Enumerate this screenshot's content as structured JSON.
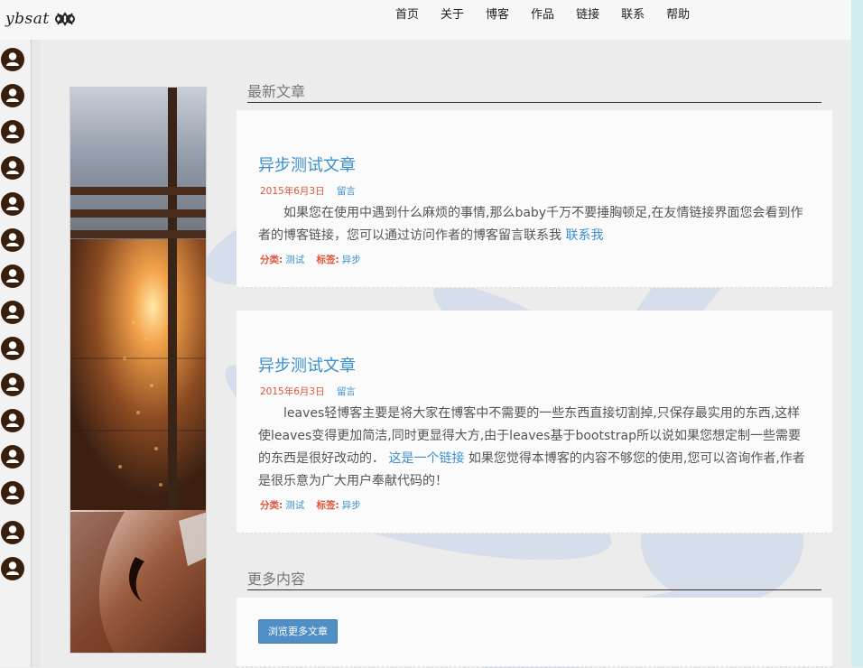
{
  "logo": {
    "text": "ybsat",
    "icon": "infinity-knot-icon"
  },
  "nav": [
    {
      "label": "首页"
    },
    {
      "label": "关于"
    },
    {
      "label": "博客"
    },
    {
      "label": "作品"
    },
    {
      "label": "链接"
    },
    {
      "label": "联系"
    },
    {
      "label": "帮助"
    }
  ],
  "latest": {
    "title": "最新文章"
  },
  "posts": [
    {
      "title": "异步测试文章",
      "date": "2015年6月3日",
      "comment": "留言",
      "body_text": "如果您在使用中遇到什么麻烦的事情,那么baby千万不要捶胸顿足,在友情链接界面您会看到作者的博客链接，您可以通过访问作者的博客留言联系我 ",
      "body_link": "联系我",
      "category_label": "分类:",
      "category": "测试",
      "tags_label": "标签:",
      "tag": "异步"
    },
    {
      "title": "异步测试文章",
      "date": "2015年6月3日",
      "comment": "留言",
      "body_text": "leaves轻博客主要是将大家在博客中不需要的一些东西直接切割掉,只保存最实用的东西,这样使leaves变得更加简洁,同时更显得大方,由于leaves基于bootstrap所以说如果您想定制一些需要的东西是很好改动的． ",
      "body_link": "这是一个链接",
      "body_text2": " 如果您觉得本博客的内容不够您的使用,您可以咨询作者,作者是很乐意为广大用户奉献代码的！",
      "category_label": "分类:",
      "category": "测试",
      "tags_label": "标签:",
      "tag": "异步"
    }
  ],
  "more": {
    "title": "更多内容",
    "button": "浏览更多文章"
  },
  "colors": {
    "accent": "#3a8fd0",
    "meta": "#e0533a",
    "button": "#4f8fc6"
  }
}
